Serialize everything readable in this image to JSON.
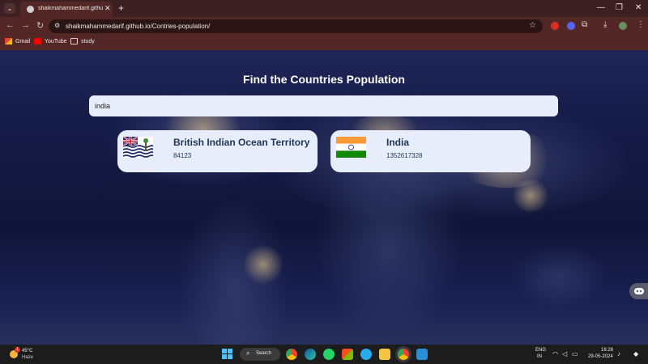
{
  "browser": {
    "tab_title": "shaikmahammedarif.github.io/",
    "url": "shaikmahammedarif.github.io/Contries-population/",
    "bookmarks": [
      {
        "label": "Gmail",
        "icon": "gmail-icon"
      },
      {
        "label": "YouTube",
        "icon": "youtube-icon"
      },
      {
        "label": "study",
        "icon": "folder-icon"
      }
    ]
  },
  "page": {
    "heading": "Find the Countries Population",
    "search_value": "india",
    "results": [
      {
        "name": "British Indian Ocean Territory",
        "population": "84123",
        "flag": "british-indian-ocean-territory-flag"
      },
      {
        "name": "India",
        "population": "1352617328",
        "flag": "india-flag"
      }
    ]
  },
  "taskbar": {
    "weather_temp": "45°C",
    "weather_cond": "Haze",
    "weather_badge": "1",
    "search_label": "Search",
    "lang_line1": "ENG",
    "lang_line2": "IN",
    "time": "16:28",
    "date": "29-05-2024"
  },
  "colors": {
    "card_bg": "#e7edfb",
    "card_text": "#1d3557",
    "tab_bar": "#3c1f22",
    "toolbar": "#522726"
  }
}
